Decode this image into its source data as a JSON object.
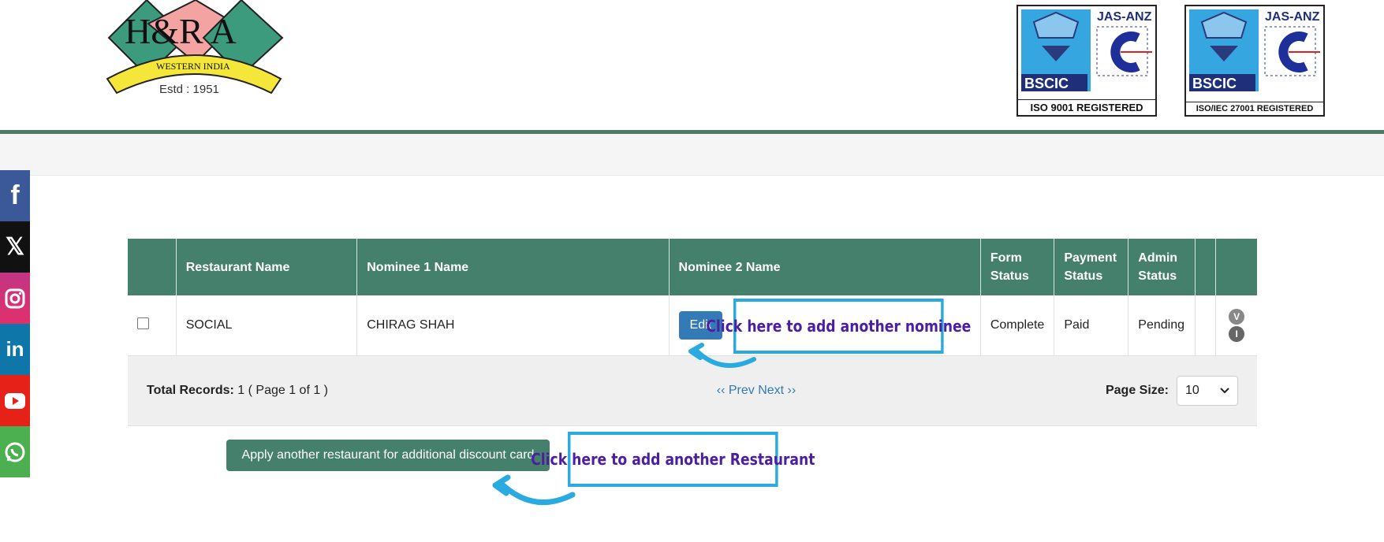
{
  "header": {
    "logo_main": "H&R A",
    "logo_ribbon": "WESTERN INDIA",
    "logo_estd": "Estd : 1951",
    "certs": [
      {
        "brand": "JAS-ANZ",
        "org": "BSCIC",
        "label": "ISO 9001 REGISTERED"
      },
      {
        "brand": "JAS-ANZ",
        "org": "BSCIC",
        "label": "ISO/IEC 27001 REGISTERED"
      }
    ]
  },
  "social": [
    {
      "icon": "facebook-icon",
      "glyph": "f"
    },
    {
      "icon": "x-twitter-icon",
      "glyph": "𝕏"
    },
    {
      "icon": "instagram-icon",
      "glyph": "◎"
    },
    {
      "icon": "linkedin-icon",
      "glyph": "in"
    },
    {
      "icon": "youtube-icon",
      "glyph": "▶"
    },
    {
      "icon": "whatsapp-icon",
      "glyph": "✆"
    }
  ],
  "table": {
    "headers": [
      "",
      "Restaurant Name",
      "Nominee 1 Name",
      "Nominee 2 Name",
      "Form Status",
      "Payment Status",
      "Admin Status",
      "",
      ""
    ],
    "rows": [
      {
        "restaurant": "SOCIAL",
        "nominee1": "CHIRAG SHAH",
        "nominee2_action": "Edit",
        "form_status": "Complete",
        "payment_status": "Paid",
        "admin_status": "Pending",
        "icon_v": "V",
        "icon_i": "I"
      }
    ],
    "footer": {
      "total_label": "Total Records:",
      "total_value": " 1 ( Page 1 of 1 )",
      "pager": "‹‹ Prev Next ››",
      "page_size_label": "Page Size:",
      "page_size_value": "10"
    }
  },
  "callouts": {
    "nominee": "Click here to add another nominee",
    "restaurant": "Click here to add another Restaurant"
  },
  "apply_button": "Apply another restaurant for additional discount card",
  "colors": {
    "header_green": "#45806c",
    "callout_border": "#29abe2",
    "callout_text": "#4b1fa0",
    "edit_blue": "#337ab7"
  }
}
